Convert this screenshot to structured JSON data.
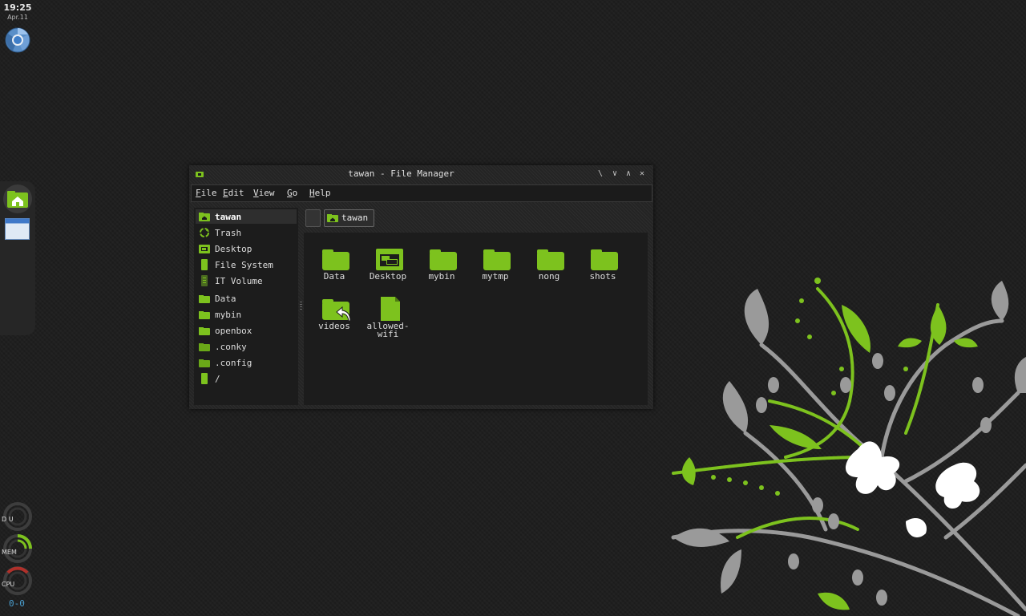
{
  "clock": {
    "time": "19:25",
    "date": "Apr.11"
  },
  "conky": {
    "du_label": "D U",
    "mem_label": "MEM",
    "cpu_label": "CPU",
    "bottom_text": "0-0"
  },
  "window": {
    "title": "tawan - File Manager",
    "menu": [
      {
        "key": "F",
        "rest": "ile"
      },
      {
        "key": "E",
        "rest": "dit"
      },
      {
        "key": "V",
        "rest": "iew"
      },
      {
        "key": "G",
        "rest": "o"
      },
      {
        "key": "H",
        "rest": "elp"
      }
    ],
    "sidebar": [
      {
        "label": "tawan",
        "icon": "home-folder-icon"
      },
      {
        "label": "Trash",
        "icon": "trash-icon"
      },
      {
        "label": "Desktop",
        "icon": "desktop-folder-icon"
      },
      {
        "label": "File System",
        "icon": "drive-icon"
      },
      {
        "label": "IT Volume",
        "icon": "volume-icon"
      },
      {
        "label": "Data",
        "icon": "folder-icon"
      },
      {
        "label": "mybin",
        "icon": "folder-icon"
      },
      {
        "label": "openbox",
        "icon": "folder-icon"
      },
      {
        "label": ".conky",
        "icon": "folder-icon"
      },
      {
        "label": ".config",
        "icon": "folder-icon"
      },
      {
        "label": "/",
        "icon": "drive-icon"
      }
    ],
    "breadcrumb": {
      "label": "tawan"
    },
    "files": [
      {
        "name": "Data",
        "icon": "folder-icon"
      },
      {
        "name": "Desktop",
        "icon": "desktop-folder-icon"
      },
      {
        "name": "mybin",
        "icon": "folder-icon"
      },
      {
        "name": "mytmp",
        "icon": "folder-icon"
      },
      {
        "name": "nong",
        "icon": "folder-icon"
      },
      {
        "name": "shots",
        "icon": "folder-icon"
      },
      {
        "name": "videos",
        "icon": "folder-link-icon"
      },
      {
        "name": "allowed-wifi",
        "icon": "file-icon"
      }
    ]
  },
  "colors": {
    "accent": "#7dc21e",
    "background": "#1f1f1f",
    "flower_gray": "#9a9a9a"
  }
}
